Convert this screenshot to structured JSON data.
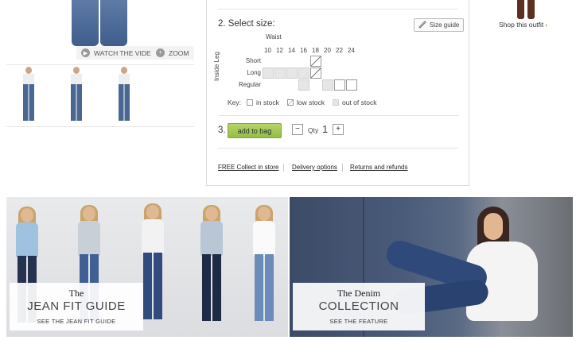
{
  "product": {
    "watch_video": "WATCH THE VIDEO",
    "zoom": "ZOOM"
  },
  "size": {
    "title": "2. Select size:",
    "size_guide": "Size guide",
    "waist_label": "Waist",
    "inside_leg_label": "Inside Leg",
    "waists": [
      "10",
      "12",
      "14",
      "16",
      "18",
      "20",
      "22",
      "24"
    ],
    "rows": [
      {
        "label": "Short",
        "cells": [
          "",
          "",
          "",
          "",
          "low",
          "",
          "",
          ""
        ]
      },
      {
        "label": "Long",
        "cells": [
          "out",
          "out",
          "out",
          "out",
          "low",
          "",
          "",
          ""
        ]
      },
      {
        "label": "Regular",
        "cells": [
          "",
          "",
          "",
          "out",
          "",
          "out",
          "in",
          "in"
        ]
      }
    ],
    "key_label": "Key:",
    "key_in": "in stock",
    "key_low": "low stock",
    "key_out": "out of stock"
  },
  "bag": {
    "step": "3.",
    "add_label": "add to bag",
    "minus": "−",
    "qty_label": "Qty",
    "qty_value": "1",
    "plus": "+"
  },
  "links": {
    "collect": "FREE Collect in store",
    "delivery": "Delivery options",
    "returns": "Returns and refunds"
  },
  "outfit": {
    "label": "Shop this outfit",
    "arrow": "›"
  },
  "banners": {
    "fit": {
      "small": "The",
      "big": "JEAN FIT GUIDE",
      "cta": "SEE THE JEAN FIT GUIDE"
    },
    "denim": {
      "small": "The Denim",
      "big": "COLLECTION",
      "cta": "SEE THE FEATURE"
    }
  },
  "colors": {
    "accent_green": "#96bd45",
    "denim_dark": "#2e3a56",
    "denim_mid": "#4a6794"
  }
}
